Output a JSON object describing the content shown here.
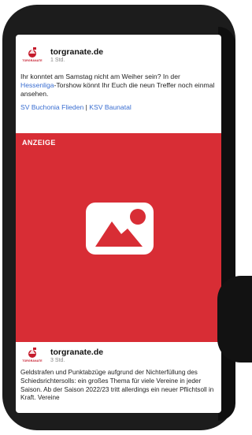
{
  "post1": {
    "author": "torgranate.de",
    "time": "1 Std.",
    "logo_text": "TORGRANATE",
    "text_before": "Ihr konntet am Samstag nicht am Weiher sein? In der ",
    "text_link": "Hessenliga",
    "text_after": "-Torshow könnt Ihr Euch die neun Treffer noch einmal ansehen.",
    "link1": "SV Buchonia Flieden",
    "link_separator": " | ",
    "link2": "KSV Baunatal"
  },
  "ad": {
    "label": "ANZEIGE",
    "icon": "image-placeholder-icon",
    "background_color": "#d82d35"
  },
  "post2": {
    "author": "torgranate.de",
    "time": "3 Std.",
    "logo_text": "TORGRANATE",
    "text": "Geldstrafen und Punktabzüge aufgrund der Nichterfüllung des Schiedsrichtersolls: ein großes Thema für viele Vereine in jeder Saison. Ab der Saison 2022/23 tritt allerdings ein neuer Pflichtsoll in Kraft. Vereine"
  },
  "colors": {
    "link": "#3a6ed1",
    "brand_red": "#c51a2b",
    "phone_body": "#1c1c1c"
  }
}
